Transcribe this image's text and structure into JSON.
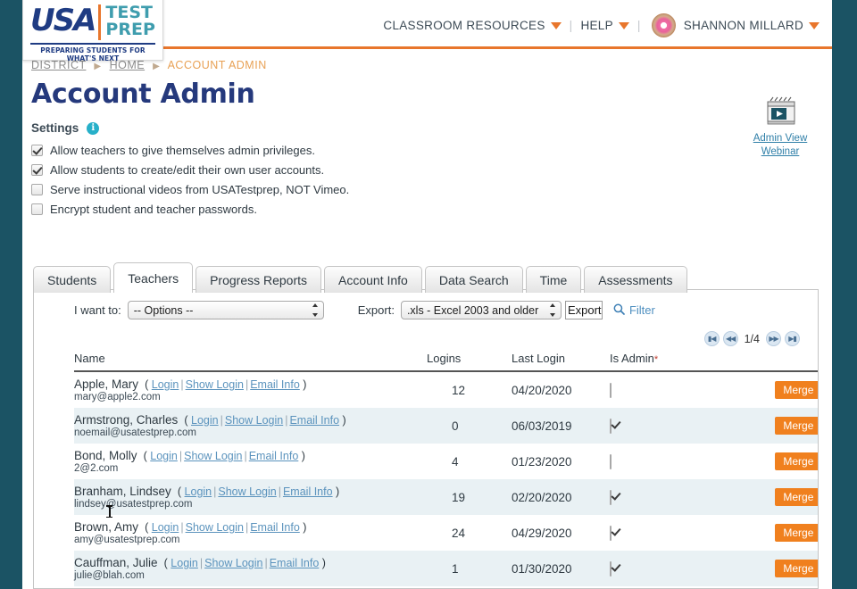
{
  "brand": {
    "logo_primary": "USA",
    "logo_secondary_line1": "TEST",
    "logo_secondary_line2": "PREP",
    "logo_tagline": "PREPARING STUDENTS FOR WHAT'S NEXT",
    "accent_orange": "#e8762c",
    "navy": "#25397c",
    "teal": "#1b5364"
  },
  "topnav": {
    "classroom_resources": "CLASSROOM RESOURCES",
    "help": "HELP",
    "user_name": "SHANNON MILLARD"
  },
  "breadcrumb": {
    "district": "DISTRICT",
    "home": "HOME",
    "current": "ACCOUNT ADMIN"
  },
  "page": {
    "title": "Account Admin",
    "settings_label": "Settings"
  },
  "settings": [
    {
      "label": "Allow teachers to give themselves admin privileges.",
      "checked": true
    },
    {
      "label": "Allow students to create/edit their own user accounts.",
      "checked": true
    },
    {
      "label": "Serve instructional videos from USATestprep, NOT Vimeo.",
      "checked": false
    },
    {
      "label": "Encrypt student and teacher passwords.",
      "checked": false
    }
  ],
  "webinar": {
    "line1": "Admin View",
    "line2": "Webinar"
  },
  "tabs": [
    {
      "label": "Students",
      "active": false
    },
    {
      "label": "Teachers",
      "active": true
    },
    {
      "label": "Progress Reports",
      "active": false
    },
    {
      "label": "Account Info",
      "active": false
    },
    {
      "label": "Data Search",
      "active": false
    },
    {
      "label": "Time",
      "active": false
    },
    {
      "label": "Assessments",
      "active": false
    }
  ],
  "toolbar": {
    "i_want_to_label": "I want to:",
    "options_value": "-- Options --",
    "export_label": "Export:",
    "export_format_value": ".xls - Excel 2003 and older",
    "export_button": "Export",
    "filter_label": "Filter"
  },
  "pager": {
    "first": "⏮",
    "prev": "◀◀",
    "page_label": "1/4",
    "next": "▶▶",
    "last": "⏭"
  },
  "table": {
    "headers": {
      "name": "Name",
      "logins": "Logins",
      "last_login": "Last Login",
      "is_admin": "Is Admin",
      "is_admin_required": "*"
    },
    "row_links": {
      "login": "Login",
      "show_login": "Show Login",
      "email_info": "Email Info"
    },
    "merge_label": "Merge",
    "rows": [
      {
        "name": "Apple, Mary",
        "email": "mary@apple2.com",
        "logins": "12",
        "last_login": "04/20/2020",
        "is_admin": false
      },
      {
        "name": "Armstrong, Charles",
        "email": "noemail@usatestprep.com",
        "logins": "0",
        "last_login": "06/03/2019",
        "is_admin": true
      },
      {
        "name": "Bond, Molly",
        "email": "2@2.com",
        "logins": "4",
        "last_login": "01/23/2020",
        "is_admin": false
      },
      {
        "name": "Branham, Lindsey",
        "email": "lindsey@usatestprep.com",
        "logins": "19",
        "last_login": "02/20/2020",
        "is_admin": true
      },
      {
        "name": "Brown, Amy",
        "email": "amy@usatestprep.com",
        "logins": "24",
        "last_login": "04/29/2020",
        "is_admin": true
      },
      {
        "name": "Cauffman, Julie",
        "email": "julie@blah.com",
        "logins": "1",
        "last_login": "01/30/2020",
        "is_admin": true
      }
    ]
  }
}
